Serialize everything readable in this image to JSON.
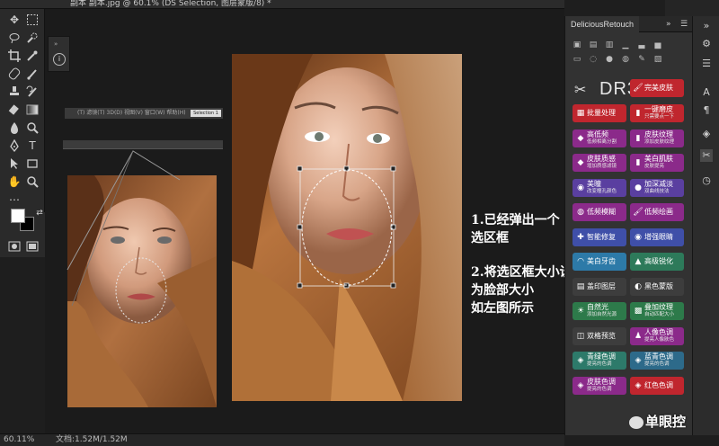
{
  "window": {
    "title": "副本 副本.jpg @ 60.1% (DS Selection, 图层蒙版/8) *"
  },
  "statusbar": {
    "zoom": "60.11%",
    "doc": "文档:1.52M/1.52M"
  },
  "mini_menu": {
    "items": "(T) 滤镜(T) 3D(D) 视图(V) 窗口(W) 帮助(H)",
    "chip": "Selection 1"
  },
  "callout": {
    "line1": "1.已经弹出一个",
    "line2": "选区框",
    "line3": "2.将选区框大小设置",
    "line4": "为脸部大小",
    "line5": "如左图所示"
  },
  "panel": {
    "tab": "DeliciousRetouch",
    "collapse": "»",
    "menu": "☰",
    "brand": "DR3",
    "buttons": [
      {
        "label": "完美皮肤",
        "sub": "",
        "color": "#c0262e",
        "icon": "brush-icon"
      },
      {
        "label": "批量处理",
        "sub": "",
        "color": "#c0262e",
        "icon": "batch-icon"
      },
      {
        "label": "一键磨皮",
        "sub": "只需要点一下",
        "color": "#c0262e",
        "icon": "bottle-icon"
      },
      {
        "label": "高低频",
        "sub": "低频相离分割",
        "color": "#8b2a8a",
        "icon": "diamond-icon"
      },
      {
        "label": "皮肤纹理",
        "sub": "添加皮肤纹理",
        "color": "#8b2a8a",
        "icon": "bottle-icon"
      },
      {
        "label": "皮肤质感",
        "sub": "增加质感滤镜",
        "color": "#8b2a8a",
        "icon": "diamond-icon"
      },
      {
        "label": "美白肌肤",
        "sub": "皮肤提亮",
        "color": "#8b2a8a",
        "icon": "bottle-icon"
      },
      {
        "label": "美瞳",
        "sub": "改变瞳孔颜色",
        "color": "#5a3fa0",
        "icon": "eye-icon"
      },
      {
        "label": "加深减淡",
        "sub": "双曲线技法",
        "color": "#5a3fa0",
        "icon": "circle-icon"
      },
      {
        "label": "低频模糊",
        "sub": "",
        "color": "#8b2a8a",
        "icon": "drop-icon"
      },
      {
        "label": "低频绘画",
        "sub": "",
        "color": "#8b2a8a",
        "icon": "brush-icon"
      },
      {
        "label": "智能修复",
        "sub": "",
        "color": "#3f4fa8",
        "icon": "bandaid-icon"
      },
      {
        "label": "增强眼睛",
        "sub": "",
        "color": "#3f4fa8",
        "icon": "eye-icon"
      },
      {
        "label": "美白牙齿",
        "sub": "",
        "color": "#2d7aa8",
        "icon": "tooth-icon"
      },
      {
        "label": "高级锐化",
        "sub": "",
        "color": "#2d7a5a",
        "icon": "triangle-icon"
      },
      {
        "label": "盖印图层",
        "sub": "",
        "color": "#3d3d3d",
        "icon": "stamp-icon"
      },
      {
        "label": "黑色蒙版",
        "sub": "",
        "color": "#3d3d3d",
        "icon": "mask-icon"
      },
      {
        "label": "自然光",
        "sub": "添加自然光源",
        "color": "#2d7a4a",
        "icon": "sun-icon"
      },
      {
        "label": "叠加纹理",
        "sub": "自动匹配大小",
        "color": "#2d7a4a",
        "icon": "texture-icon"
      },
      {
        "label": "双格预览",
        "sub": "",
        "color": "#3d3d3d",
        "icon": "split-icon"
      },
      {
        "label": "人像色调",
        "sub": "提亮人像肤色",
        "color": "#8b2a8a",
        "icon": "person-icon"
      },
      {
        "label": "青绿色调",
        "sub": "提亮的色调",
        "color": "#2d7a6a",
        "icon": "palette-icon"
      },
      {
        "label": "蓝青色调",
        "sub": "提亮的色调",
        "color": "#2d6a8a",
        "icon": "palette-icon"
      },
      {
        "label": "皮肤色调",
        "sub": "提亮的色调",
        "color": "#8b2a8a",
        "icon": "palette-icon"
      },
      {
        "label": "红色色调",
        "sub": "",
        "color": "#c0262e",
        "icon": "palette-icon"
      }
    ]
  },
  "watermark": "单眼控"
}
